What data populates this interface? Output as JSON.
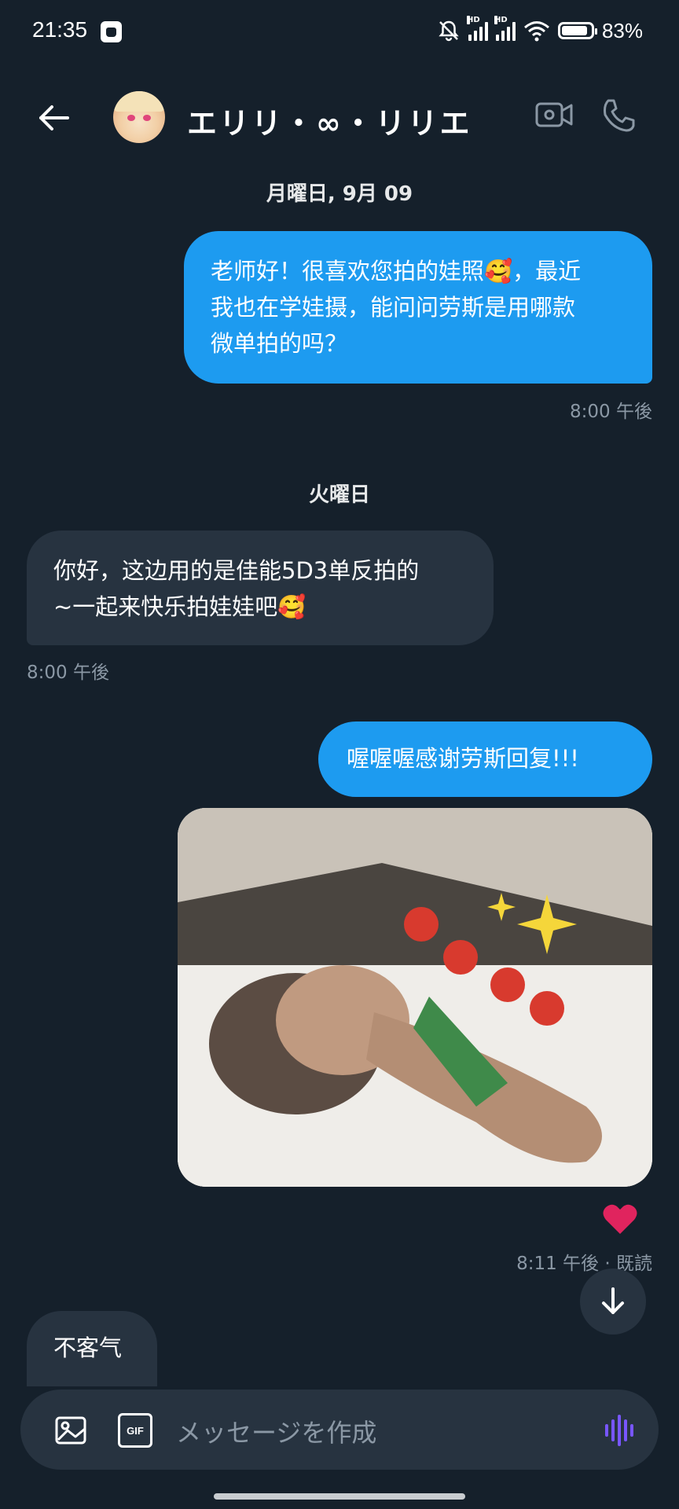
{
  "status_bar": {
    "time": "21:35",
    "battery": "83%",
    "network_labels": [
      "HD",
      "HD"
    ]
  },
  "header": {
    "contact_name": "エリリ・∞・リリエ",
    "icons": {
      "back": "arrow-left-icon",
      "video": "video-camera-icon",
      "call": "phone-icon"
    }
  },
  "conversation": {
    "date_1": "月曜日, 9月 09",
    "msg_1": {
      "line1": "老师好！很喜欢您拍的娃照🥰，最近",
      "line2": "我也在学娃摄，能问问劳斯是用哪款",
      "line3": "微单拍的吗？",
      "time": "8:00 午後"
    },
    "date_2": "火曜日",
    "msg_2": {
      "line1": "你好，这边用的是佳能5D3单反拍的",
      "line2": "~一起来快乐拍娃娃吧🥰",
      "time": "8:00 午後"
    },
    "msg_3": {
      "text": "喔喔喔感谢劳斯回复!!!"
    },
    "msg_4": {
      "reaction": "❤️",
      "meta": "8:11 午後 · 既読"
    },
    "msg_5": {
      "text": "不客气"
    }
  },
  "composer": {
    "placeholder": "メッセージを作成",
    "gif_label": "GIF"
  },
  "colors": {
    "background": "#15202b",
    "outgoing_bubble": "#1d9bf0",
    "incoming_bubble": "#273340",
    "meta_text": "#8b98a5",
    "voice_accent": "#7856ff"
  }
}
